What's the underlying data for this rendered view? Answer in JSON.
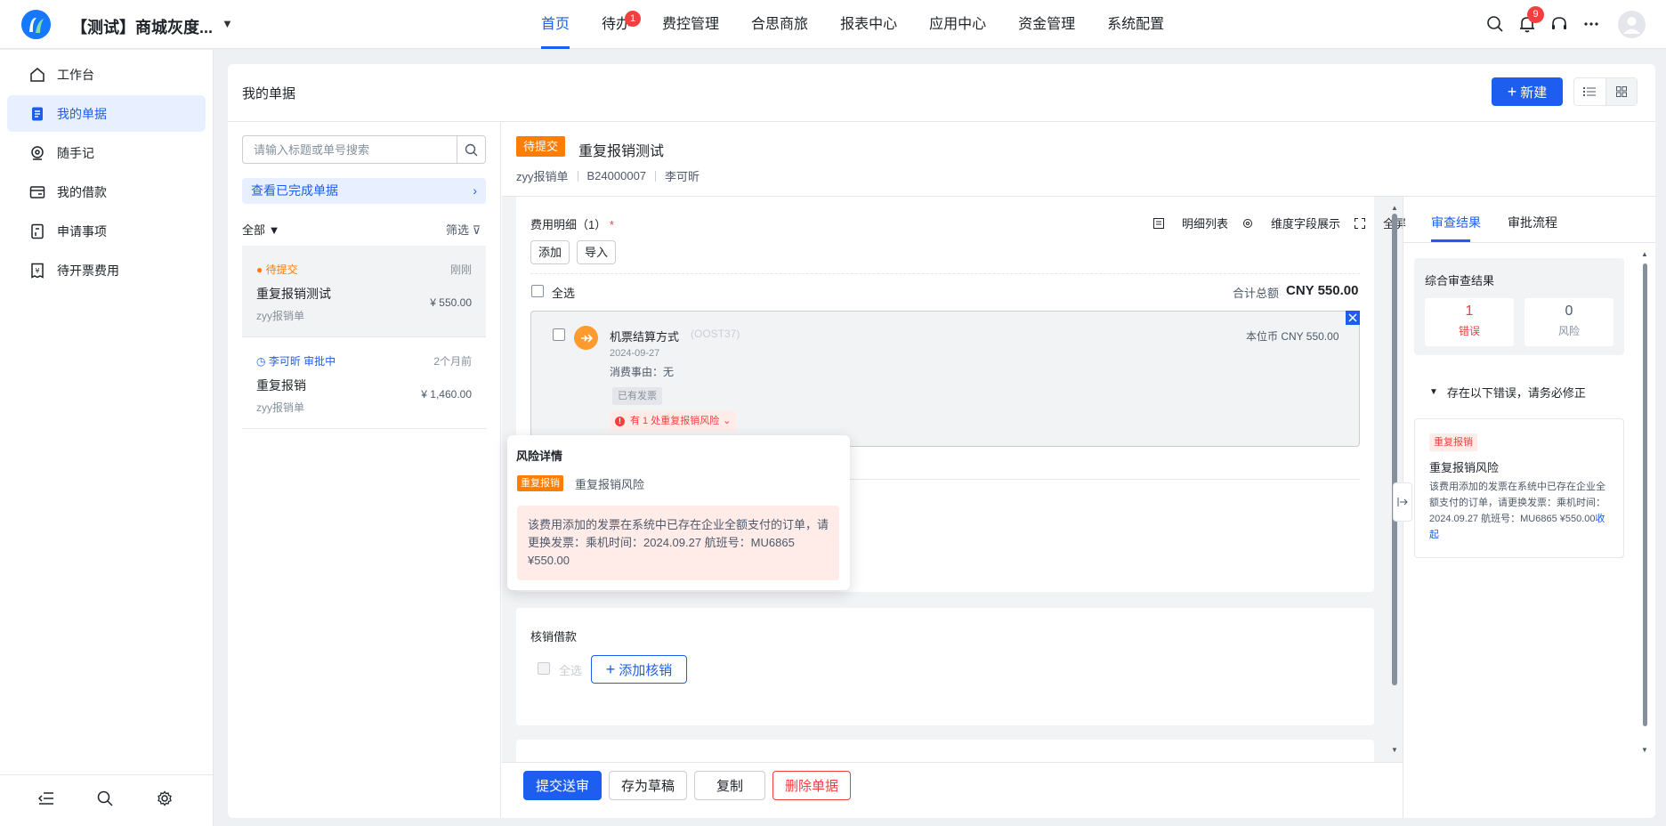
{
  "app": {
    "title": "【测试】商城灰度...",
    "logo": "app-logo"
  },
  "nav": [
    {
      "label": "首页",
      "active": true
    },
    {
      "label": "待办",
      "badge": "1"
    },
    {
      "label": "费控管理"
    },
    {
      "label": "合思商旅"
    },
    {
      "label": "报表中心"
    },
    {
      "label": "应用中心"
    },
    {
      "label": "资金管理"
    },
    {
      "label": "系统配置"
    }
  ],
  "topbar": {
    "notification_badge": "9",
    "icons": [
      "search-icon",
      "bell-icon",
      "headset-icon",
      "more-icon",
      "avatar"
    ]
  },
  "sidebar": {
    "items": [
      {
        "label": "工作台",
        "icon": "home-icon"
      },
      {
        "label": "我的单据",
        "icon": "document-icon",
        "active": true
      },
      {
        "label": "随手记",
        "icon": "note-icon"
      },
      {
        "label": "我的借款",
        "icon": "wallet-icon"
      },
      {
        "label": "申请事项",
        "icon": "request-icon"
      },
      {
        "label": "待开票费用",
        "icon": "invoice-icon"
      }
    ],
    "bottom_icons": [
      "collapse-icon",
      "search-icon",
      "settings-icon"
    ]
  },
  "page": {
    "title": "我的单据",
    "new_button": "新建"
  },
  "list": {
    "search_placeholder": "请输入标题或单号搜索",
    "completed_link": "查看已完成单据",
    "filter_all": "全部",
    "filter_label": "筛选",
    "items": [
      {
        "status": "待提交",
        "time": "刚刚",
        "title": "重复报销测试",
        "type": "zyy报销单",
        "amount": "¥ 550.00",
        "status_color": "#ff7d00"
      },
      {
        "status_user": "李可昕",
        "status": "审批中",
        "time": "2个月前",
        "title": "重复报销",
        "type": "zyy报销单",
        "amount": "¥ 1,460.00",
        "status_color": "#1d5ef0"
      }
    ]
  },
  "detail": {
    "status_tag": "待提交",
    "title": "重复报销测试",
    "form_type": "zyy报销单",
    "number": "B24000007",
    "owner": "李可昕",
    "expense_section": {
      "label": "费用明细（1）",
      "required_mark": "*",
      "tools": [
        "明细列表",
        "维度字段展示",
        "全屏"
      ],
      "add_button": "添加",
      "import_button": "导入",
      "select_all": "全选",
      "total_label": "合计总额",
      "total_value": "CNY 550.00"
    },
    "expense": {
      "name": "机票结算方式",
      "code": "(OOST37)",
      "date": "2024-09-27",
      "reason": "消费事由：无",
      "invoice_tag": "已有发票",
      "risk_chip": "有 1 处重复报销风险",
      "base_amount": "本位币 CNY 550.00"
    },
    "risk_popup": {
      "title": "风险详情",
      "tag": "重复报销",
      "risk_name": "重复报销风险",
      "message": "该费用添加的发票在系统中已存在企业全额支付的订单，请更换发票：乘机时间：2024.09.27 航班号：MU6865 ¥550.00"
    },
    "verify_section": {
      "label": "核销借款",
      "select_all": "全选",
      "add_button": "添加核销"
    },
    "footer": {
      "submit": "提交送审",
      "draft": "存为草稿",
      "copy": "复制",
      "delete": "删除单据"
    }
  },
  "review": {
    "tabs": [
      "审查结果",
      "审批流程"
    ],
    "summary_title": "综合审查结果",
    "errors": {
      "count": "1",
      "label": "错误",
      "color": "#f53f3f"
    },
    "risks": {
      "count": "0",
      "label": "风险"
    },
    "error_heading": "存在以下错误，请务必修正",
    "error_card": {
      "tag": "重复报销",
      "title": "重复报销风险",
      "desc": "该费用添加的发票在系统中已存在企业全额支付的订单，请更换发票：乘机时间：2024.09.27 航班号：MU6865 ¥550.00",
      "link": "收起"
    }
  },
  "colors": {
    "primary": "#1d5ef0",
    "warning": "#ff7d00",
    "danger": "#f53f3f"
  }
}
